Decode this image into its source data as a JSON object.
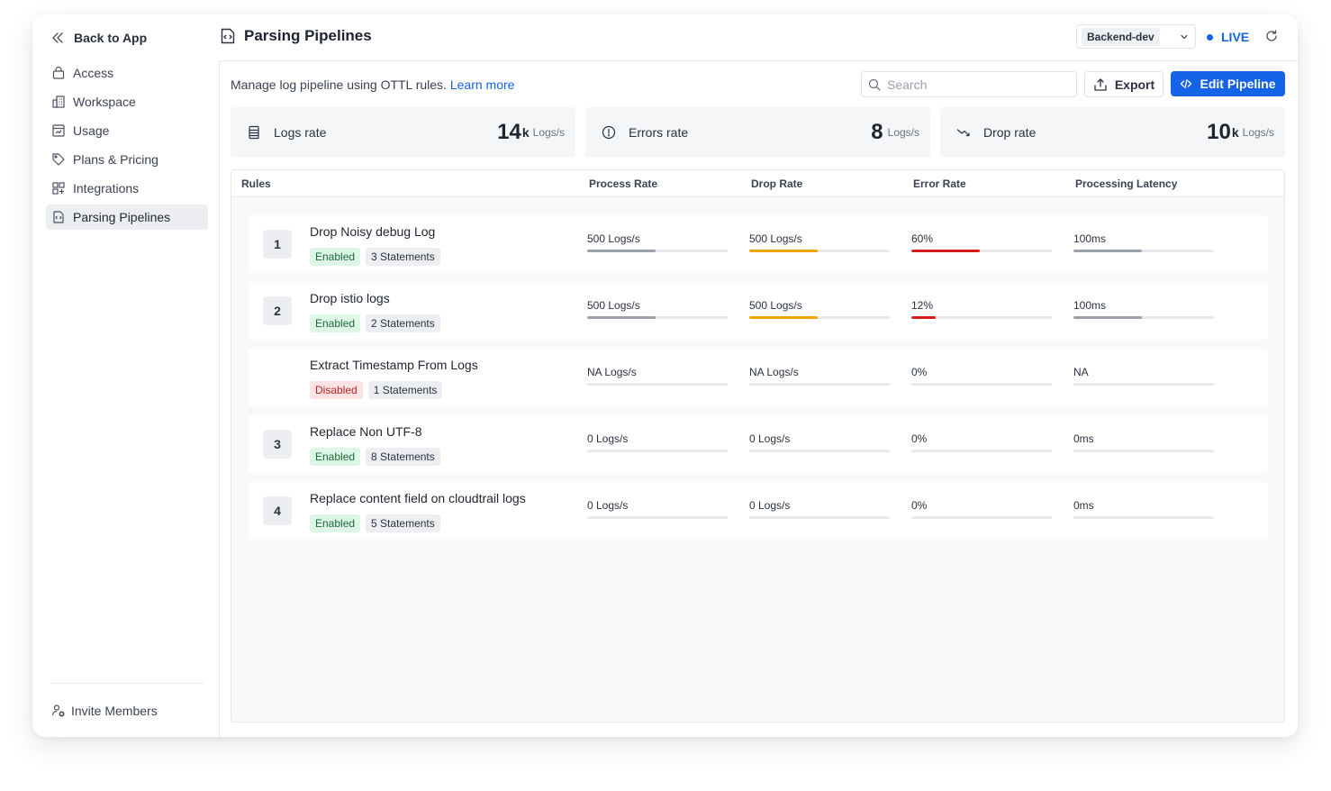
{
  "sidebar": {
    "back_label": "Back to App",
    "items": [
      {
        "label": "Access",
        "icon": "lock-icon"
      },
      {
        "label": "Workspace",
        "icon": "building-icon"
      },
      {
        "label": "Usage",
        "icon": "usage-icon"
      },
      {
        "label": "Plans & Pricing",
        "icon": "tag-icon"
      },
      {
        "label": "Integrations",
        "icon": "grid-plus-icon"
      },
      {
        "label": "Parsing Pipelines",
        "icon": "pipeline-icon",
        "active": true
      }
    ],
    "invite_label": "Invite Members"
  },
  "header": {
    "title": "Parsing Pipelines",
    "environment": "Backend-dev",
    "live_label": "LIVE"
  },
  "toolbar": {
    "description": "Manage log pipeline using OTTL rules.",
    "learn_more": "Learn more",
    "search_placeholder": "Search",
    "export_label": "Export",
    "edit_label": "Edit Pipeline"
  },
  "stats": [
    {
      "label": "Logs rate",
      "value": "14",
      "suffix": "k",
      "unit": "Logs/s"
    },
    {
      "label": "Errors rate",
      "value": "8",
      "suffix": "",
      "unit": "Logs/s"
    },
    {
      "label": "Drop rate",
      "value": "10",
      "suffix": "k",
      "unit": "Logs/s"
    }
  ],
  "table": {
    "columns": [
      "Rules",
      "Process Rate",
      "Drop Rate",
      "Error Rate",
      "Processing Latency"
    ],
    "rows": [
      {
        "index": "1",
        "name": "Drop Noisy debug Log",
        "status": "Enabled",
        "statements": "3 Statements",
        "process": "500 Logs/s",
        "process_fill": 0.49,
        "drop": "500 Logs/s",
        "drop_fill": 0.49,
        "error": "60%",
        "error_fill": 0.49,
        "latency": "100ms",
        "latency_fill": 0.49
      },
      {
        "index": "2",
        "name": "Drop istio logs",
        "status": "Enabled",
        "statements": "2 Statements",
        "process": "500 Logs/s",
        "process_fill": 0.49,
        "drop": "500 Logs/s",
        "drop_fill": 0.49,
        "error": "12%",
        "error_fill": 0.17,
        "latency": "100ms",
        "latency_fill": 0.49
      },
      {
        "index": "",
        "name": "Extract Timestamp From Logs",
        "status": "Disabled",
        "statements": "1 Statements",
        "process": "NA Logs/s",
        "process_fill": 0,
        "drop": "NA Logs/s",
        "drop_fill": 0,
        "error": "0%",
        "error_fill": 0,
        "latency": "NA",
        "latency_fill": 0
      },
      {
        "index": "3",
        "name": "Replace Non UTF-8",
        "status": "Enabled",
        "statements": "8 Statements",
        "process": "0 Logs/s",
        "process_fill": 0,
        "drop": "0 Logs/s",
        "drop_fill": 0,
        "error": "0%",
        "error_fill": 0,
        "latency": "0ms",
        "latency_fill": 0
      },
      {
        "index": "4",
        "name": "Replace content field on cloudtrail logs",
        "status": "Enabled",
        "statements": "5 Statements",
        "process": "0 Logs/s",
        "process_fill": 0,
        "drop": "0 Logs/s",
        "drop_fill": 0,
        "error": "0%",
        "error_fill": 0,
        "latency": "0ms",
        "latency_fill": 0
      }
    ]
  },
  "colors": {
    "accent": "#1463e8",
    "process_bar": "#9aa1ad",
    "drop_bar": "#f0a400",
    "error_bar": "#d81b1b",
    "latency_bar": "#9aa1ad"
  }
}
